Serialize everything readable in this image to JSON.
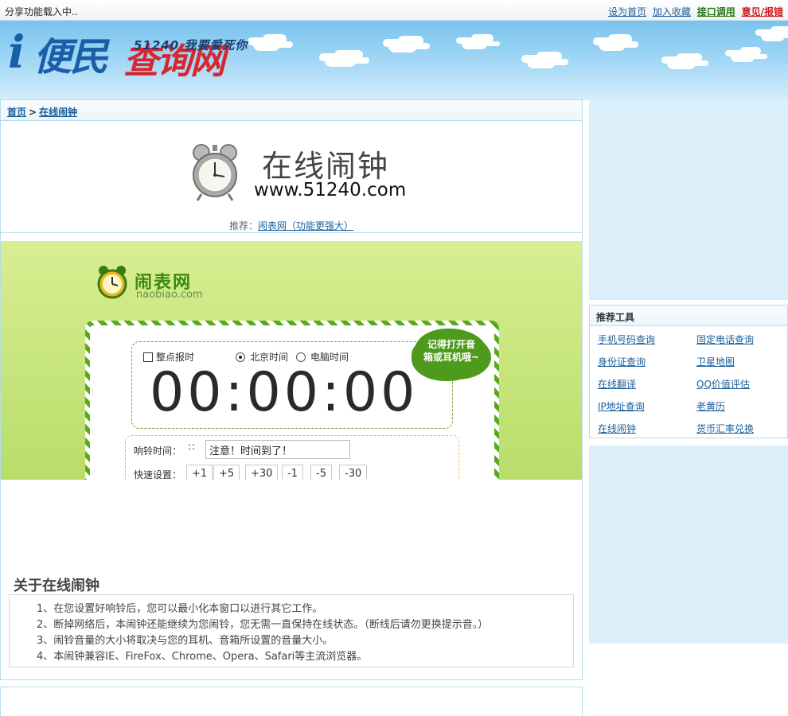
{
  "topbar": {
    "loading_text": "分享功能载入中..",
    "links": [
      {
        "label": "设为首页",
        "style": "blue"
      },
      {
        "label": "加入收藏",
        "style": "blue"
      },
      {
        "label": "接口调用",
        "style": "green"
      },
      {
        "label": "意见/报错",
        "style": "red"
      }
    ]
  },
  "logo": {
    "letter": "i",
    "name_part1": "便民",
    "name_part2": "查询网",
    "slogan": "51240 我要爱死你"
  },
  "breadcrumb": {
    "home": "首页",
    "separator": ">",
    "current": "在线闹钟"
  },
  "hero": {
    "title": "在线闹钟",
    "url": "www.51240.com",
    "recommend_prefix": "推荐：",
    "recommend_link": "闹表网（功能更强大）"
  },
  "widget": {
    "brand_name": "闹表网",
    "brand_url": "naobiao.com",
    "options": {
      "chime_label": "整点报时",
      "beijing_time_label": "北京时间",
      "computer_time_label": "电脑时间",
      "selected": "北京时间"
    },
    "time": "00:00:00",
    "bubble_line1": "记得打开音",
    "bubble_line2": "箱或耳机哦~",
    "alarm_label": "响铃时间：",
    "alarm_dots": "::",
    "message_value": "注意！时间到了！",
    "quick_label": "快速设置：",
    "quick_buttons": [
      "+1",
      "+5",
      "+30",
      "-1",
      "-5",
      "-30"
    ]
  },
  "about": {
    "title": "关于在线闹钟",
    "items": [
      "1、在您设置好响铃后，您可以最小化本窗口以进行其它工作。",
      "2、断掉网络后，本闹钟还能继续为您闹铃，您无需一直保持在线状态。（断线后请勿更换提示音。）",
      "3、闹铃音量的大小将取决与您的耳机、音箱所设置的音量大小。",
      "4、本闹钟兼容IE、FireFox、Chrome、Opera、Safari等主流浏览器。"
    ]
  },
  "sidebar": {
    "tools_title": "推荐工具",
    "tools": [
      "手机号码查询",
      "固定电话查询",
      "身份证查询",
      "卫星地图",
      "在线翻译",
      "QQ价值评估",
      "IP地址查询",
      "老黄历",
      "在线闹钟",
      "货币汇率兑换"
    ]
  },
  "colors": {
    "link_blue": "#1a5e9a",
    "link_green": "#2a7a12",
    "link_red": "#d21a1a",
    "widget_green": "#4e9a1c",
    "panel_border": "#b8dbec"
  }
}
